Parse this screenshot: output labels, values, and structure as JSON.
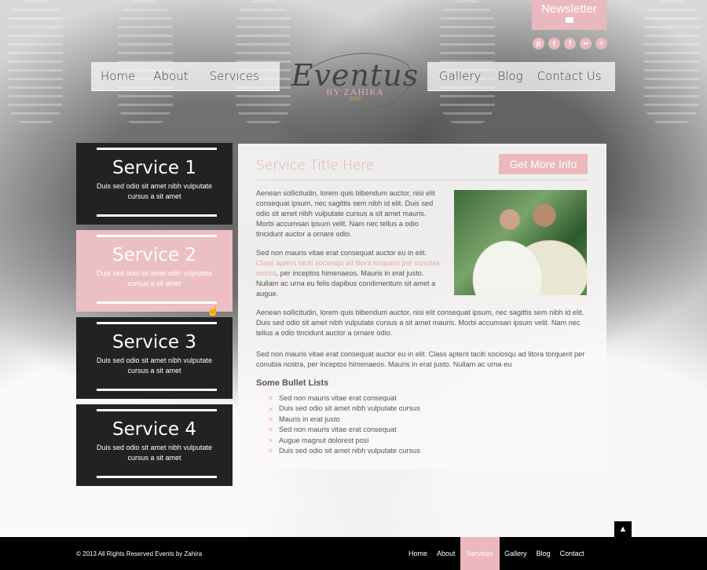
{
  "brand": {
    "logo_script": "Eventus",
    "logo_by": "BY ZAHIRA",
    "logo_year": "2002",
    "accent_color": "#ebb8be"
  },
  "newsletter": {
    "label": "Newsletter",
    "icon": "envelope-icon"
  },
  "social": [
    {
      "name": "pinterest-icon",
      "glyph": "p"
    },
    {
      "name": "twitter-icon",
      "glyph": "t"
    },
    {
      "name": "facebook-icon",
      "glyph": "f"
    },
    {
      "name": "flickr-icon",
      "glyph": "••"
    },
    {
      "name": "chat-icon",
      "glyph": "≡"
    }
  ],
  "nav_left": [
    "Home",
    "About",
    "Services"
  ],
  "nav_right": [
    "Gallery",
    "Blog",
    "Contact Us"
  ],
  "services": [
    {
      "title": "Service 1",
      "desc": "Duis sed odio sit amet nibh vulputate cursus a sit amet"
    },
    {
      "title": "Service 2",
      "desc": "Duis sed odio sit amet nibh vulputate cursus a sit amet"
    },
    {
      "title": "Service 3",
      "desc": "Duis sed odio sit amet nibh vulputate cursus a sit amet"
    },
    {
      "title": "Service 4",
      "desc": "Duis sed odio sit amet nibh vulputate cursus a sit amet"
    }
  ],
  "content": {
    "title": "Service Title Here",
    "cta": "Get More Info",
    "p1": "Aenean sollicitudin, lorem quis bibendum auctor, nisi elit consequat ipsum, nec sagittis sem nibh id elit. Duis sed odio sit amet nibh vulputate cursus a sit amet mauris. Morbi accumsan ipsum velit. Nam nec tellus a odio tincidunt auctor a ornare odio.",
    "p2_start": "Sed non  mauris vitae erat consequat auctor eu in elit. ",
    "p2_link": "Class aptent taciti sociosqu ad litora torquent per conubia nostra",
    "p2_end": ", per inceptos himenaeos. Mauris in erat justo. Nullam ac urna eu felis dapibus condimentum sit amet a augue.",
    "p3": "Aenean sollicitudin, lorem quis bibendum auctor, nisi elit consequat ipsum, nec sagittis sem nibh id elit. Duis sed odio sit amet nibh vulputate cursus a sit amet mauris. Morbi accumsan ipsum velit. Nam nec tellus a odio tincidunt auctor a ornare odio.",
    "p4": "Sed non  mauris vitae erat consequat auctor eu in elit. Class aptent taciti sociosqu ad litora torquent per conubia nostra, per inceptos himenaeos. Mauris in erat justo. Nullam ac urna eu",
    "bullets_heading": "Some Bullet Lists",
    "bullets": [
      "Sed non  mauris vitae erat consequat",
      "Duis sed odio sit amet nibh vulputate cursus",
      "Mauris in erat justo",
      "Sed non  mauris vitae erat consequat",
      "Augue magnut dolorest posi",
      "Duis sed odio sit amet nibh vulputate cursus"
    ]
  },
  "footer": {
    "copyright": "© 2013 All Rights Reserved Events by Zahira",
    "links": [
      "Home",
      "About",
      "Services",
      "Gallery",
      "Blog",
      "Contact"
    ],
    "active": "Services",
    "to_top": "▲"
  }
}
